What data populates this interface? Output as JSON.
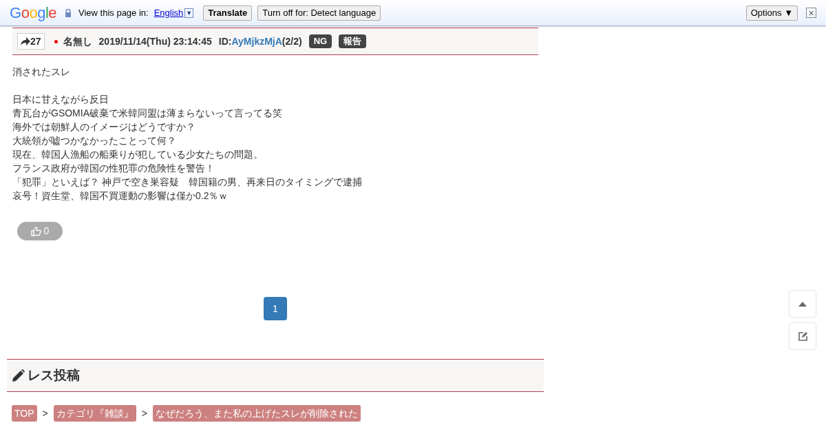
{
  "translate_bar": {
    "logo": "Google",
    "prompt": "View this page in:",
    "language": "English",
    "language_caret": "▼",
    "translate_button": "Translate",
    "turn_off_button": "Turn off for: Detect language",
    "options_button": "Options ▼",
    "close": "×"
  },
  "post": {
    "share_count": "27",
    "name": "名無し",
    "datetime": "2019/11/14(Thu) 23:14:45",
    "id_label": "ID:",
    "id": "AyMjkzMjA",
    "id_count": "(2/2)",
    "badges": [
      "NG",
      "報告"
    ],
    "first_line": "消されたスレ",
    "lines": [
      "日本に甘えながら反日",
      "青瓦台がGSOMIA破棄で米韓同盟は薄まらないって言ってる笑",
      "海外では朝鮮人のイメージはどうですか？",
      "大統領が嘘つかなかったことって何？",
      "現在、韓国人漁船の船乗りが犯している少女たちの問題。",
      "フランス政府が韓国の性犯罪の危険性を警告！",
      "「犯罪」といえば？ 神戸で空き巣容疑　韓国籍の男、再来日のタイミングで逮捕",
      "哀号！資生堂、韓国不買運動の影響は僅か0.2％ｗ"
    ],
    "likes": "0"
  },
  "pagination": [
    {
      "label": "1",
      "selected": true
    }
  ],
  "reply_section": {
    "title": "レス投稿"
  },
  "breadcrumbs": [
    {
      "label": "TOP"
    },
    {
      "label": "カテゴリ『雑談』"
    },
    {
      "label": "なぜだろう、また私の上げたスレが削除された"
    }
  ],
  "breadcrumb_separator": ">"
}
